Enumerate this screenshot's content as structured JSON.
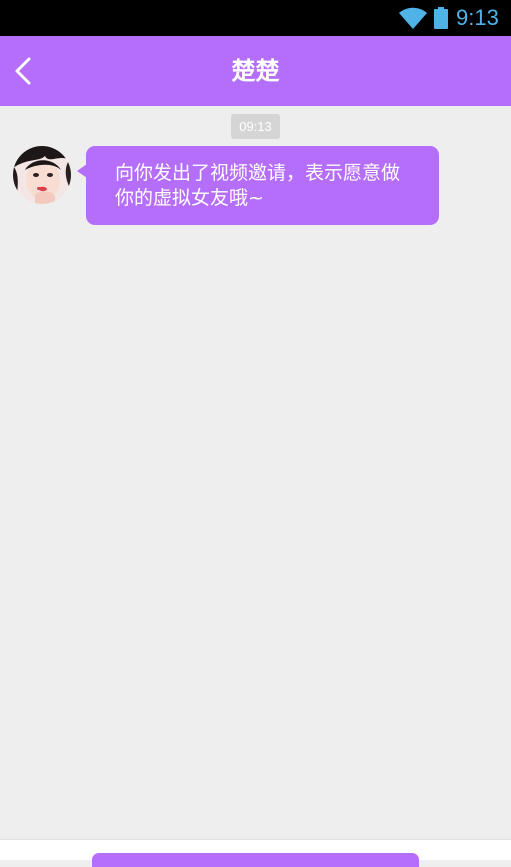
{
  "status_bar": {
    "time": "9:13",
    "wifi_icon": "wifi-icon",
    "battery_icon": "battery-icon",
    "time_color": "#4fb3e8"
  },
  "nav": {
    "title": "楚楚",
    "back_icon": "back-chevron-icon",
    "background_color": "#b56ef9"
  },
  "chat": {
    "timestamp": "09:13",
    "messages": [
      {
        "sender_avatar": "avatar-image",
        "text": "向你发出了视频邀请，表示愿意做你的虚拟女友哦~"
      }
    ]
  },
  "bottom_bar": {
    "button_color": "#b56ef9"
  }
}
